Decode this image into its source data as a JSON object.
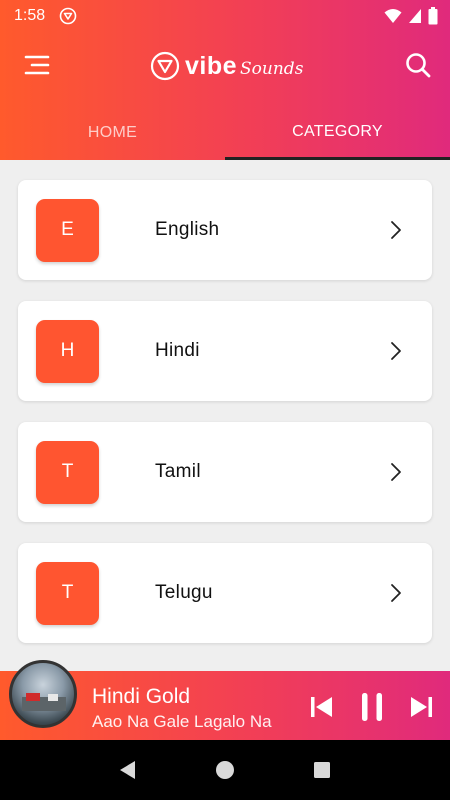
{
  "status_bar": {
    "time": "1:58"
  },
  "brand": {
    "name": "vibe",
    "tagline": "Sounds"
  },
  "tabs": [
    {
      "label": "HOME",
      "active": false
    },
    {
      "label": "CATEGORY",
      "active": true
    }
  ],
  "categories": [
    {
      "letter": "E",
      "name": "English"
    },
    {
      "letter": "H",
      "name": "Hindi"
    },
    {
      "letter": "T",
      "name": "Tamil"
    },
    {
      "letter": "T",
      "name": "Telugu"
    }
  ],
  "player": {
    "title": "Hindi Gold",
    "subtitle": "Aao Na Gale Lagalo Na"
  },
  "colors": {
    "accent": "#ff5530",
    "gradient_start": "#ff5a2c",
    "gradient_end": "#e02a7c"
  },
  "icons": {
    "menu": "menu-icon",
    "search": "search-icon",
    "chevron": "chevron-right-icon",
    "prev": "skip-previous-icon",
    "pause": "pause-icon",
    "next": "skip-next-icon"
  }
}
